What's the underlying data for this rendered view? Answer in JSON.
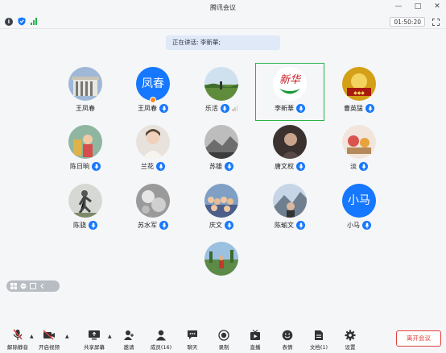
{
  "window": {
    "title": "腾讯会议"
  },
  "status": {
    "timer": "01:50:20"
  },
  "speaking": {
    "text": "正在讲话: 李新華;"
  },
  "participants": [
    {
      "name": "王凤春",
      "avatar": "building-photo",
      "mic": false
    },
    {
      "name": "王凤春",
      "avatar_text": "凤春",
      "mic": true,
      "host": true
    },
    {
      "name": "乐活",
      "avatar": "grassland-photo",
      "mic": true,
      "volume": true
    },
    {
      "name": "李新華",
      "avatar": "calligraphy-logo",
      "logo_text": "新华",
      "mic": true,
      "speaking": true
    },
    {
      "name": "曹英猛",
      "avatar": "golden-art-photo",
      "mic": true
    },
    {
      "name": "陈日晌",
      "avatar": "kids-photo",
      "mic": true
    },
    {
      "name": "兰花",
      "avatar": "woman-photo",
      "mic": true
    },
    {
      "name": "苏雄",
      "avatar": "bw-landscape-photo",
      "mic": true
    },
    {
      "name": "唐文权",
      "avatar": "dark-portrait-photo",
      "mic": true
    },
    {
      "name": "淡",
      "avatar": "food-photo",
      "mic": true
    },
    {
      "name": "陈骁",
      "avatar": "jumping-photo",
      "mic": true
    },
    {
      "name": "苏水军",
      "avatar": "bw-flowers-photo",
      "mic": true
    },
    {
      "name": "庆文",
      "avatar": "crowd-photo",
      "mic": true
    },
    {
      "name": "陈瑜文",
      "avatar": "mountain-photo",
      "mic": true
    },
    {
      "name": "小马",
      "avatar_text": "小马",
      "mic": true
    },
    {
      "name": "",
      "avatar": "outdoor-person-photo",
      "mic": false
    }
  ],
  "toolbar": {
    "mute": "解除静音",
    "video": "开启视频",
    "share": "共享屏幕",
    "invite": "邀请",
    "members": "成员(16)",
    "chat": "聊天",
    "record": "录制",
    "live": "直播",
    "reactions": "表情",
    "docs": "文档(1)",
    "settings": "设置",
    "leave": "离开会议"
  },
  "colors": {
    "accent": "#1677ff",
    "speaking_border": "#26b34a",
    "leave": "#e0403a"
  }
}
